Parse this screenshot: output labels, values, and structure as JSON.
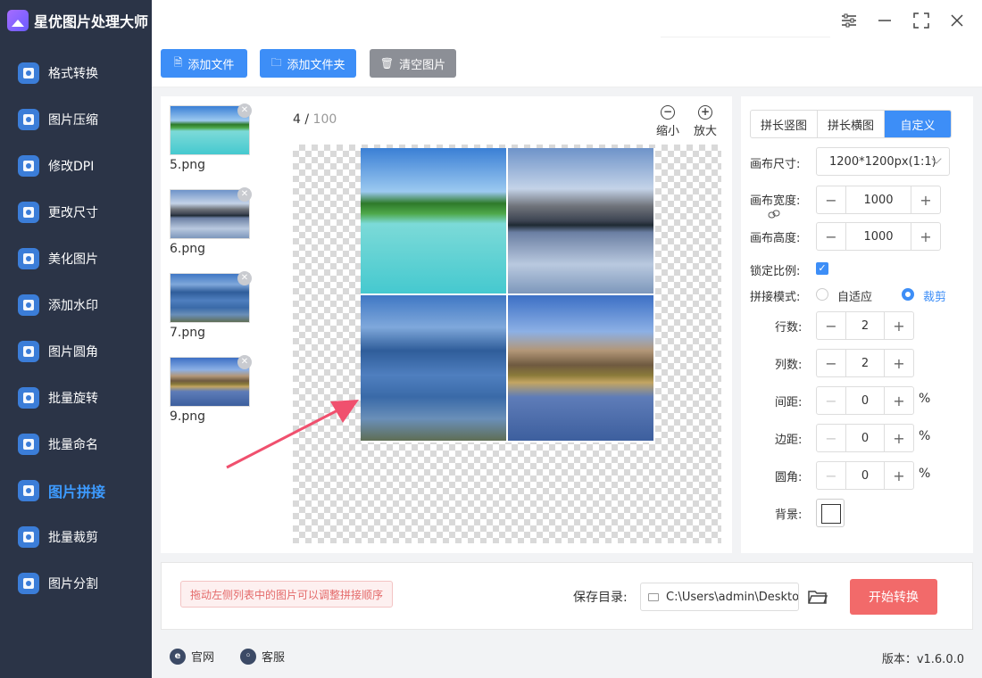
{
  "app": {
    "title": "星优图片处理大师"
  },
  "sidebar": {
    "items": [
      {
        "label": "格式转换",
        "icon": "format-convert-icon",
        "color": "#3b7dd8"
      },
      {
        "label": "图片压缩",
        "icon": "compress-icon",
        "color": "#3b7dd8"
      },
      {
        "label": "修改DPI",
        "icon": "dpi-icon",
        "color": "#3b7dd8"
      },
      {
        "label": "更改尺寸",
        "icon": "resize-icon",
        "color": "#3b7dd8"
      },
      {
        "label": "美化图片",
        "icon": "beautify-icon",
        "color": "#3b7dd8"
      },
      {
        "label": "添加水印",
        "icon": "watermark-icon",
        "color": "#3b7dd8"
      },
      {
        "label": "图片圆角",
        "icon": "round-corner-icon",
        "color": "#3b7dd8"
      },
      {
        "label": "批量旋转",
        "icon": "rotate-icon",
        "color": "#3b7dd8"
      },
      {
        "label": "批量命名",
        "icon": "rename-icon",
        "color": "#3b7dd8"
      },
      {
        "label": "图片拼接",
        "icon": "stitch-icon",
        "color": "#3b7dd8",
        "active": true
      },
      {
        "label": "批量裁剪",
        "icon": "crop-icon",
        "color": "#3b7dd8"
      },
      {
        "label": "图片分割",
        "icon": "split-icon",
        "color": "#3b7dd8"
      }
    ]
  },
  "toolbar": {
    "add_file": "添加文件",
    "add_folder": "添加文件夹",
    "clear": "清空图片"
  },
  "files": [
    {
      "name": "5.png",
      "scene": "beach"
    },
    {
      "name": "6.png",
      "scene": "lake"
    },
    {
      "name": "7.png",
      "scene": "mist"
    },
    {
      "name": "9.png",
      "scene": "dusk"
    }
  ],
  "preview": {
    "current": "4",
    "separator": " / ",
    "total": "100",
    "zoom_out": "缩小",
    "zoom_in": "放大"
  },
  "settings": {
    "modes": [
      "拼长竖图",
      "拼长横图",
      "自定义"
    ],
    "active_mode": "自定义",
    "canvas_size_label": "画布尺寸:",
    "canvas_size_value": "1200*1200px(1:1)",
    "canvas_width_label": "画布宽度:",
    "canvas_width_value": "1000",
    "canvas_height_label": "画布高度:",
    "canvas_height_value": "1000",
    "lock_ratio_label": "锁定比例:",
    "stitch_mode_label": "拼接模式:",
    "stitch_options": [
      "自适应",
      "裁剪"
    ],
    "stitch_selected": "裁剪",
    "rows_label": "行数:",
    "rows_value": "2",
    "cols_label": "列数:",
    "cols_value": "2",
    "spacing_label": "间距:",
    "spacing_value": "0",
    "margin_label": "边距:",
    "margin_value": "0",
    "radius_label": "圆角:",
    "radius_value": "0",
    "unit": "%",
    "bg_label": "背景:"
  },
  "bottom": {
    "hint": "拖动左侧列表中的图片可以调整拼接顺序",
    "save_label": "保存目录:",
    "save_path": "C:\\Users\\admin\\Desktop",
    "start": "开始转换"
  },
  "footer": {
    "website": "官网",
    "support": "客服",
    "version": "版本：v1.6.0.0"
  },
  "colors": {
    "accent": "#3d8ef7",
    "sidebar_bg": "#2b3447",
    "start_button": "#f26a6a",
    "clear_button": "#8c8f96"
  }
}
